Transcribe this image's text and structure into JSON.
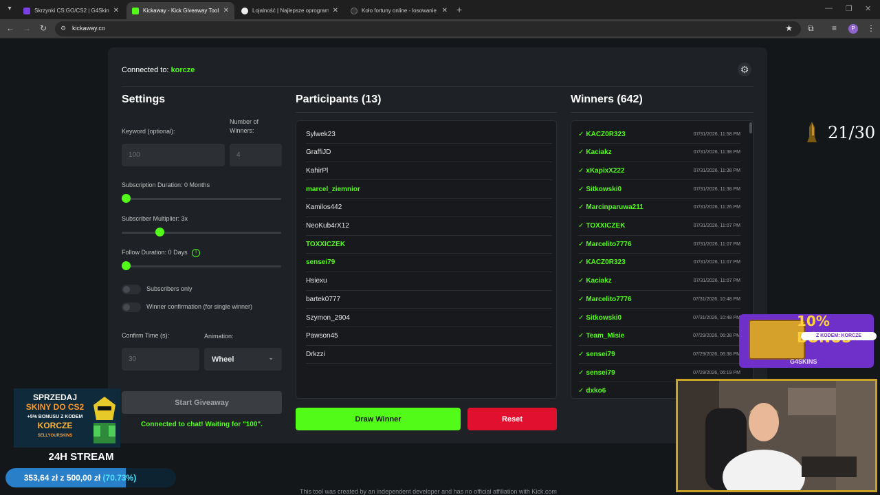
{
  "browser": {
    "tabs": [
      {
        "title": "Skrzynki CS:GO/CS2 | G4Skins",
        "active": false,
        "favicon_color": "#7b3fe4"
      },
      {
        "title": "Kickaway - Kick Giveaway Tool",
        "active": true,
        "favicon_color": "#53fc18"
      },
      {
        "title": "Lojalność | Najlepsze oprogram",
        "active": false,
        "favicon_color": "#eeeeee"
      },
      {
        "title": "Koło fortuny online - losowanie",
        "active": false,
        "favicon_color": "#333333"
      }
    ],
    "url": "kickaway.co",
    "profile_initial": "P"
  },
  "header": {
    "connected_label": "Connected to:",
    "channel": "korcze"
  },
  "settings": {
    "title": "Settings",
    "keyword_label": "Keyword (optional):",
    "keyword_value": "100",
    "winners_label": "Number of Winners:",
    "winners_value": "4",
    "sub_duration_label": "Subscription Duration: 0 Months",
    "sub_duration_value": 0,
    "sub_multiplier_label": "Subscriber Multiplier: 3x",
    "sub_multiplier_value": 0.25,
    "follow_label": "Follow Duration:",
    "follow_value": "0",
    "follow_unit": "Days",
    "subscribers_only_label": "Subscribers only",
    "winner_confirmation_label": "Winner confirmation (for single winner)",
    "confirm_time_label": "Confirm Time (s):",
    "confirm_time_value": "30",
    "animation_label": "Animation:",
    "animation_value": "Wheel",
    "start_button": "Start Giveaway",
    "status_text": "Connected to chat! Waiting for \"100\"."
  },
  "participants": {
    "title": "Participants (13)",
    "items": [
      {
        "name": "Sylwek23",
        "sub": false
      },
      {
        "name": "GraffiJD",
        "sub": false
      },
      {
        "name": "KahirPl",
        "sub": false
      },
      {
        "name": "marcel_ziemnior",
        "sub": true
      },
      {
        "name": "Kamilos442",
        "sub": false
      },
      {
        "name": "NeoKub4rX12",
        "sub": false
      },
      {
        "name": "TOXXICZEK",
        "sub": true
      },
      {
        "name": "sensei79",
        "sub": true
      },
      {
        "name": "Hsiexu",
        "sub": false
      },
      {
        "name": "bartek0777",
        "sub": false
      },
      {
        "name": "Szymon_2904",
        "sub": false
      },
      {
        "name": "Pawson45",
        "sub": false
      },
      {
        "name": "Drkzzi",
        "sub": false
      }
    ]
  },
  "winners": {
    "title": "Winners (642)",
    "items": [
      {
        "name": "KACZ0R323",
        "date": "07/31/2026, 11:58 PM"
      },
      {
        "name": "Kaciakz",
        "date": "07/31/2026, 11:38 PM"
      },
      {
        "name": "xKapixX222",
        "date": "07/31/2026, 11:38 PM"
      },
      {
        "name": "Sitkowski0",
        "date": "07/31/2026, 11:38 PM"
      },
      {
        "name": "Marcinparuwa211",
        "date": "07/31/2026, 11:26 PM"
      },
      {
        "name": "TOXXICZEK",
        "date": "07/31/2026, 11:07 PM"
      },
      {
        "name": "Marcelito7776",
        "date": "07/31/2026, 11:07 PM"
      },
      {
        "name": "KACZ0R323",
        "date": "07/31/2026, 11:07 PM"
      },
      {
        "name": "Kaciakz",
        "date": "07/31/2026, 11:07 PM"
      },
      {
        "name": "Marcelito7776",
        "date": "07/31/2026, 10:48 PM"
      },
      {
        "name": "Sitkowski0",
        "date": "07/31/2026, 10:48 PM"
      },
      {
        "name": "Team_Misie",
        "date": "07/29/2026, 06:38 PM"
      },
      {
        "name": "sensei79",
        "date": "07/29/2026, 06:38 PM"
      },
      {
        "name": "sensei79",
        "date": "07/29/2026, 06:19 PM"
      },
      {
        "name": "dxko6",
        "date": ""
      }
    ]
  },
  "actions": {
    "draw": "Draw Winner",
    "reset": "Reset"
  },
  "footer": "This tool was created by an independent developer and has no official affiliation with Kick.com",
  "overlay": {
    "counter": "21/30",
    "promo_lines": [
      "SPRZEDAJ",
      "SKINY DO CS2",
      "+5% BONUSU Z KODEM",
      "KORCZE",
      "SELLYOURSKINS"
    ],
    "stream_label": "24H STREAM",
    "goal_current": "353,64 zł",
    "goal_sep": "z",
    "goal_target": "500,00 zł",
    "goal_percent": "(70.73%)",
    "goal_fraction": 0.7073,
    "bonus_big": "10% BONUS",
    "bonus_code": "Z KODEM: KORCZE",
    "bonus_brand": "G4SKINS"
  },
  "colors": {
    "kick_green": "#53fc18",
    "reset_red": "#e2102f",
    "panel": "#1e2125"
  }
}
